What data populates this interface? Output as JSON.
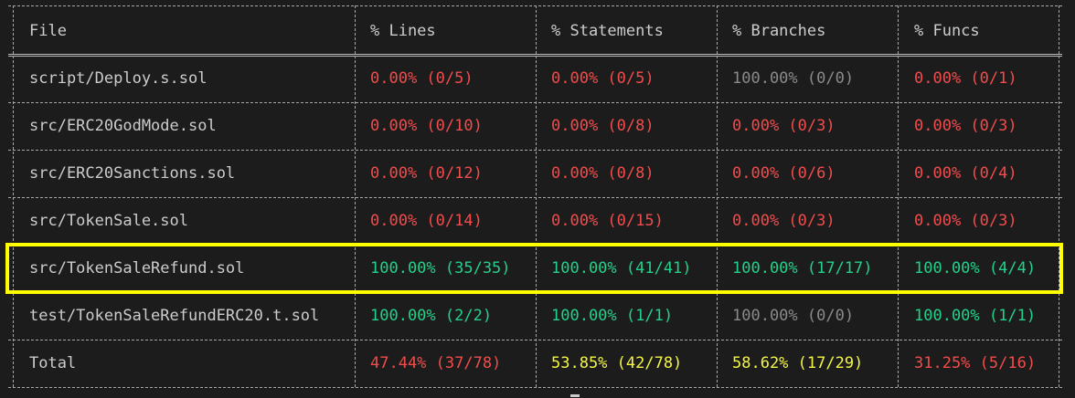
{
  "headers": [
    "File",
    "% Lines",
    "% Statements",
    "% Branches",
    "% Funcs"
  ],
  "rows": [
    {
      "file": "script/Deploy.s.sol",
      "lines": "0.00% (0/5)",
      "lines_color": "red",
      "statements": "0.00% (0/5)",
      "statements_color": "red",
      "branches": "100.00% (0/0)",
      "branches_color": "gray",
      "funcs": "0.00% (0/1)",
      "funcs_color": "red"
    },
    {
      "file": "src/ERC20GodMode.sol",
      "lines": "0.00% (0/10)",
      "lines_color": "red",
      "statements": "0.00% (0/8)",
      "statements_color": "red",
      "branches": "0.00% (0/3)",
      "branches_color": "red",
      "funcs": "0.00% (0/3)",
      "funcs_color": "red"
    },
    {
      "file": "src/ERC20Sanctions.sol",
      "lines": "0.00% (0/12)",
      "lines_color": "red",
      "statements": "0.00% (0/8)",
      "statements_color": "red",
      "branches": "0.00% (0/6)",
      "branches_color": "red",
      "funcs": "0.00% (0/4)",
      "funcs_color": "red"
    },
    {
      "file": "src/TokenSale.sol",
      "lines": "0.00% (0/14)",
      "lines_color": "red",
      "statements": "0.00% (0/15)",
      "statements_color": "red",
      "branches": "0.00% (0/3)",
      "branches_color": "red",
      "funcs": "0.00% (0/3)",
      "funcs_color": "red"
    },
    {
      "file": "src/TokenSaleRefund.sol",
      "lines": "100.00% (35/35)",
      "lines_color": "green",
      "statements": "100.00% (41/41)",
      "statements_color": "green",
      "branches": "100.00% (17/17)",
      "branches_color": "green",
      "funcs": "100.00% (4/4)",
      "funcs_color": "green"
    },
    {
      "file": "test/TokenSaleRefundERC20.t.sol",
      "lines": "100.00% (2/2)",
      "lines_color": "green",
      "statements": "100.00% (1/1)",
      "statements_color": "green",
      "branches": "100.00% (0/0)",
      "branches_color": "gray",
      "funcs": "100.00% (1/1)",
      "funcs_color": "green"
    },
    {
      "file": "Total",
      "lines": "47.44% (37/78)",
      "lines_color": "red",
      "statements": "53.85% (42/78)",
      "statements_color": "yellow",
      "branches": "58.62% (17/29)",
      "branches_color": "yellow",
      "funcs": "31.25% (5/16)",
      "funcs_color": "red"
    }
  ],
  "highlight_row": "src/TokenSaleRefund.sol",
  "colors": {
    "background": "#1c1c1c",
    "red": "#f14c4c",
    "green": "#23d18b",
    "gray": "#8a8a8a",
    "yellow": "#f5f543",
    "highlight": "#ffff00"
  }
}
